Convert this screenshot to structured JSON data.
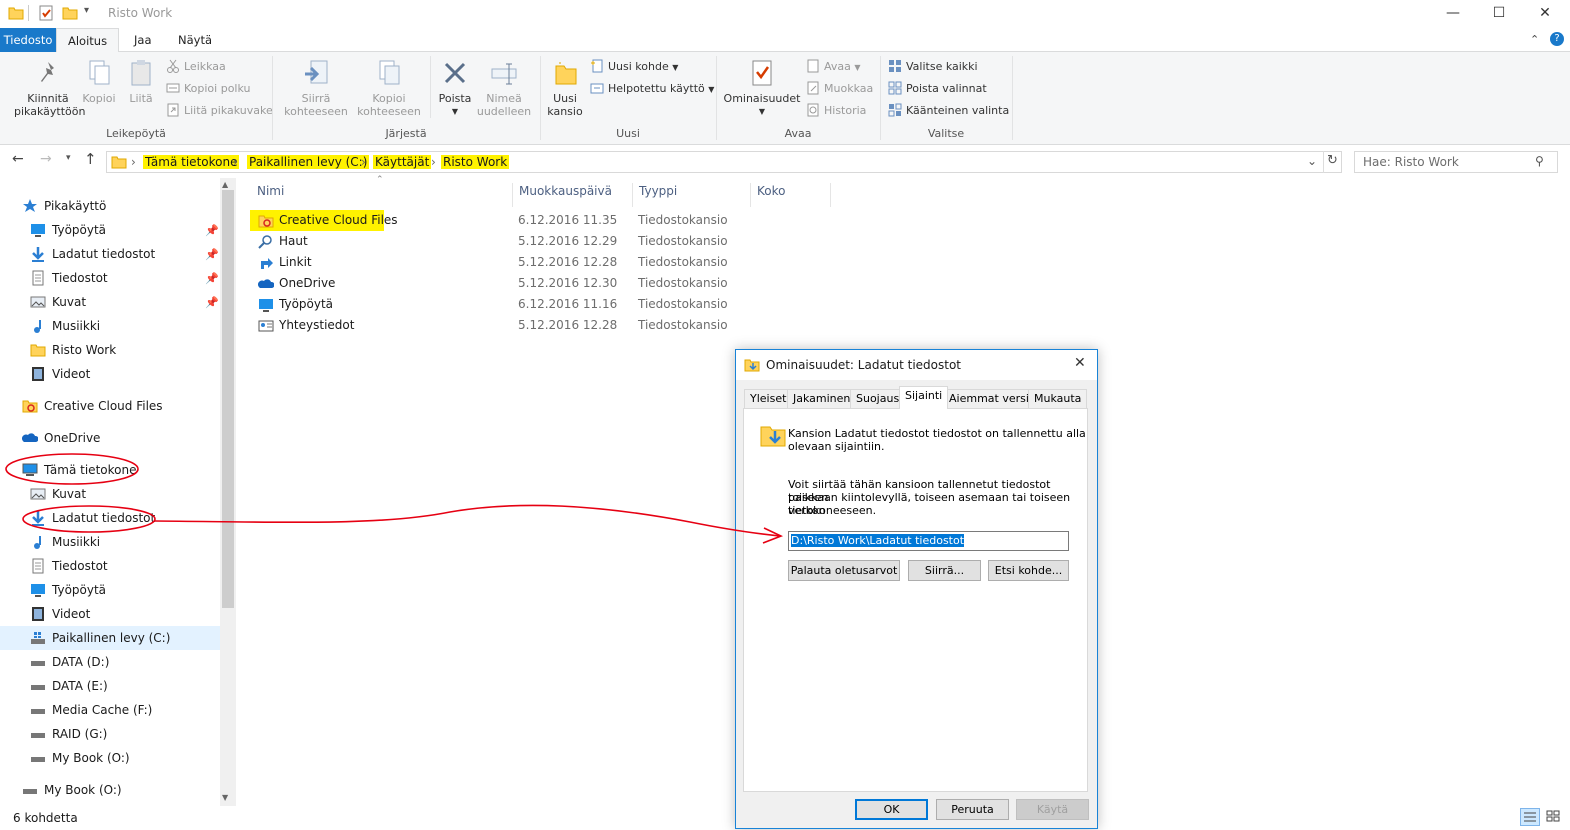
{
  "window": {
    "title": "Risto Work",
    "minimize": "—",
    "maximize": "☐",
    "close": "✕"
  },
  "tabs": [
    {
      "label": "Tiedosto"
    },
    {
      "label": "Aloitus"
    },
    {
      "label": "Jaa"
    },
    {
      "label": "Näytä"
    }
  ],
  "ribbon": {
    "clipboard": {
      "group": "Leikepöytä",
      "pin": "Kiinnitä\npikakäyttöön",
      "copy": "Kopioi",
      "paste": "Liitä",
      "cut": "Leikkaa",
      "copy_path": "Kopioi polku",
      "paste_shortcut": "Liitä pikakuvake"
    },
    "organize": {
      "group": "Järjestä",
      "move_to": "Siirrä\nkohteeseen",
      "copy_to": "Kopioi\nkohteeseen",
      "delete": "Poista",
      "rename": "Nimeä\nuudelleen"
    },
    "new": {
      "group": "Uusi",
      "new_folder": "Uusi\nkansio",
      "new_item": "Uusi kohde",
      "easy_access": "Helpotettu käyttö"
    },
    "open": {
      "group": "Avaa",
      "properties": "Ominaisuudet",
      "open": "Avaa",
      "edit": "Muokkaa",
      "history": "Historia"
    },
    "select": {
      "group": "Valitse",
      "select_all": "Valitse kaikki",
      "select_none": "Poista valinnat",
      "invert": "Käänteinen valinta"
    }
  },
  "address": {
    "crumbs": [
      "Tämä tietokone",
      "Paikallinen levy (C:)",
      "Käyttäjät",
      "Risto Work"
    ],
    "search_placeholder": "Hae: Risto Work"
  },
  "nav": {
    "quick_access": "Pikakäyttö",
    "quick_items": [
      "Työpöytä",
      "Ladatut tiedostot",
      "Tiedostot",
      "Kuvat",
      "Musiikki",
      "Risto Work",
      "Videot"
    ],
    "creative_cloud": "Creative Cloud Files",
    "onedrive": "OneDrive",
    "this_pc": "Tämä tietokone",
    "pc_items": [
      "Kuvat",
      "Ladatut tiedostot",
      "Musiikki",
      "Tiedostot",
      "Työpöytä",
      "Videot",
      "Paikallinen levy (C:)",
      "DATA (D:)",
      "DATA (E:)",
      "Media Cache (F:)",
      "RAID (G:)",
      "My Book (O:)"
    ],
    "my_book": "My Book (O:)"
  },
  "columns": {
    "name": "Nimi",
    "modified": "Muokkauspäivä",
    "type": "Tyyppi",
    "size": "Koko"
  },
  "files": [
    {
      "name": "Creative Cloud Files",
      "date": "6.12.2016 11.35",
      "type": "Tiedostokansio",
      "icon": "creative-cloud-folder"
    },
    {
      "name": "Haut",
      "date": "5.12.2016 12.29",
      "type": "Tiedostokansio",
      "icon": "search-folder"
    },
    {
      "name": "Linkit",
      "date": "5.12.2016 12.28",
      "type": "Tiedostokansio",
      "icon": "links-folder"
    },
    {
      "name": "OneDrive",
      "date": "5.12.2016 12.30",
      "type": "Tiedostokansio",
      "icon": "onedrive-folder"
    },
    {
      "name": "Työpöytä",
      "date": "6.12.2016 11.16",
      "type": "Tiedostokansio",
      "icon": "desktop-folder"
    },
    {
      "name": "Yhteystiedot",
      "date": "5.12.2016 12.28",
      "type": "Tiedostokansio",
      "icon": "contacts-folder"
    }
  ],
  "status": {
    "count": "6 kohdetta"
  },
  "dialog": {
    "title": "Ominaisuudet: Ladatut tiedostot",
    "tabs": [
      "Yleiset",
      "Jakaminen",
      "Suojaus",
      "Sijainti",
      "Aiemmat versiot",
      "Mukauta"
    ],
    "info_line1": "Kansion Ladatut tiedostot tiedostot on tallennettu alla",
    "info_line2": "olevaan sijaintiin.",
    "desc_line1": "Voit siirtää tähän kansioon tallennetut tiedostot toiseen",
    "desc_line2": "paikkaan kiintolevyllä, toiseen asemaan tai toiseen verkon",
    "desc_line3": "tietokoneeseen.",
    "path": "D:\\Risto Work\\Ladatut tiedostot",
    "restore": "Palauta oletusarvot",
    "move": "Siirrä...",
    "find": "Etsi kohde...",
    "ok": "OK",
    "cancel": "Peruuta",
    "apply": "Käytä"
  },
  "colors": {
    "accent": "#1979ca",
    "highlight": "#fff200",
    "annotation": "#e60012"
  }
}
